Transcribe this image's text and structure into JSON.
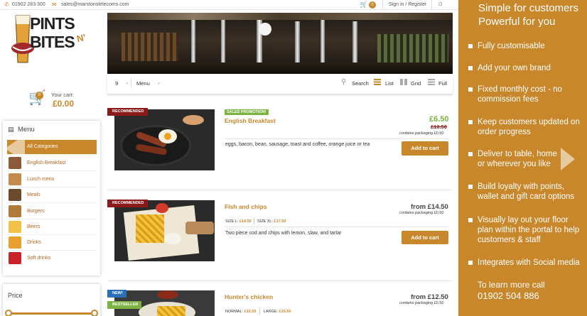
{
  "topbar": {
    "phone": "01902 283 300",
    "email": "sales@marstonstelecoms.com",
    "cart_count": "0",
    "signin": "Sign in / Register"
  },
  "logo": {
    "line1": "PINTS",
    "amp": "N'",
    "line2": "BITES"
  },
  "cart": {
    "label": "Your cart:",
    "amount": "£0.00",
    "badge": "0"
  },
  "menu": {
    "title": "Menu",
    "categories": [
      {
        "label": "All Categories"
      },
      {
        "label": "English Breakfast"
      },
      {
        "label": "Lunch menu"
      },
      {
        "label": "Meals"
      },
      {
        "label": "Burgers"
      },
      {
        "label": "Beers"
      },
      {
        "label": "Drinks"
      },
      {
        "label": "Soft drinks"
      }
    ]
  },
  "price_filter": {
    "title": "Price"
  },
  "toolbar": {
    "per_page": "9",
    "sort": "Menu",
    "search": "Search",
    "list": "List",
    "grid": "Grid",
    "full": "Full"
  },
  "products": [
    {
      "ribbon": "RECOMMENDED",
      "promo": "SALES PROMOTION!",
      "name": "English Breakfast",
      "price": "£6.50",
      "old_price": "£10.50",
      "packaging": "contains packaging £0.50",
      "desc": "eggs, bacon, bean, sausage, toast and coffee, orange juice or tea",
      "button": "Add to cart"
    },
    {
      "ribbon": "RECOMMENDED",
      "name": "Fish and chips",
      "price": "from £14.50",
      "packaging": "contains packaging £0.50",
      "size1_label": "SIZE L:",
      "size1_price": "£14.50",
      "size2_label": "SIZE XL:",
      "size2_price": "£17.50",
      "desc": "Two piece cod and chips with lemon, slaw, and tartar",
      "button": "Add to cart"
    },
    {
      "ribbon": "NEW!",
      "ribbon2": "BESTSELLER",
      "name": "Hunter's chicken",
      "price": "from £12.50",
      "packaging": "contains packaging £0.50",
      "size1_label": "NORMAL:",
      "size1_price": "£12.50",
      "size2_label": "LARGE:",
      "size2_price": "£15.50"
    }
  ],
  "promo": {
    "heading1": "Simple for customers",
    "heading2": "Powerful for you",
    "items": [
      "Fully customisable",
      "Add your own brand",
      "Fixed monthly cost - no commission fees",
      "Keep customers updated on order progress",
      "Deliver to table, home or wherever you like",
      "Build loyalty with points, wallet and gift card options",
      "Visually lay out your floor plan within the portal to help customers & staff",
      "Integrates with Social media"
    ],
    "learn": "To learn more call",
    "phone": "01902 504 886"
  },
  "colors": {
    "accent": "#c9872b",
    "ribbon": "#8b1a1a",
    "promo_green": "#7cb342",
    "new_blue": "#2a6fb8"
  }
}
